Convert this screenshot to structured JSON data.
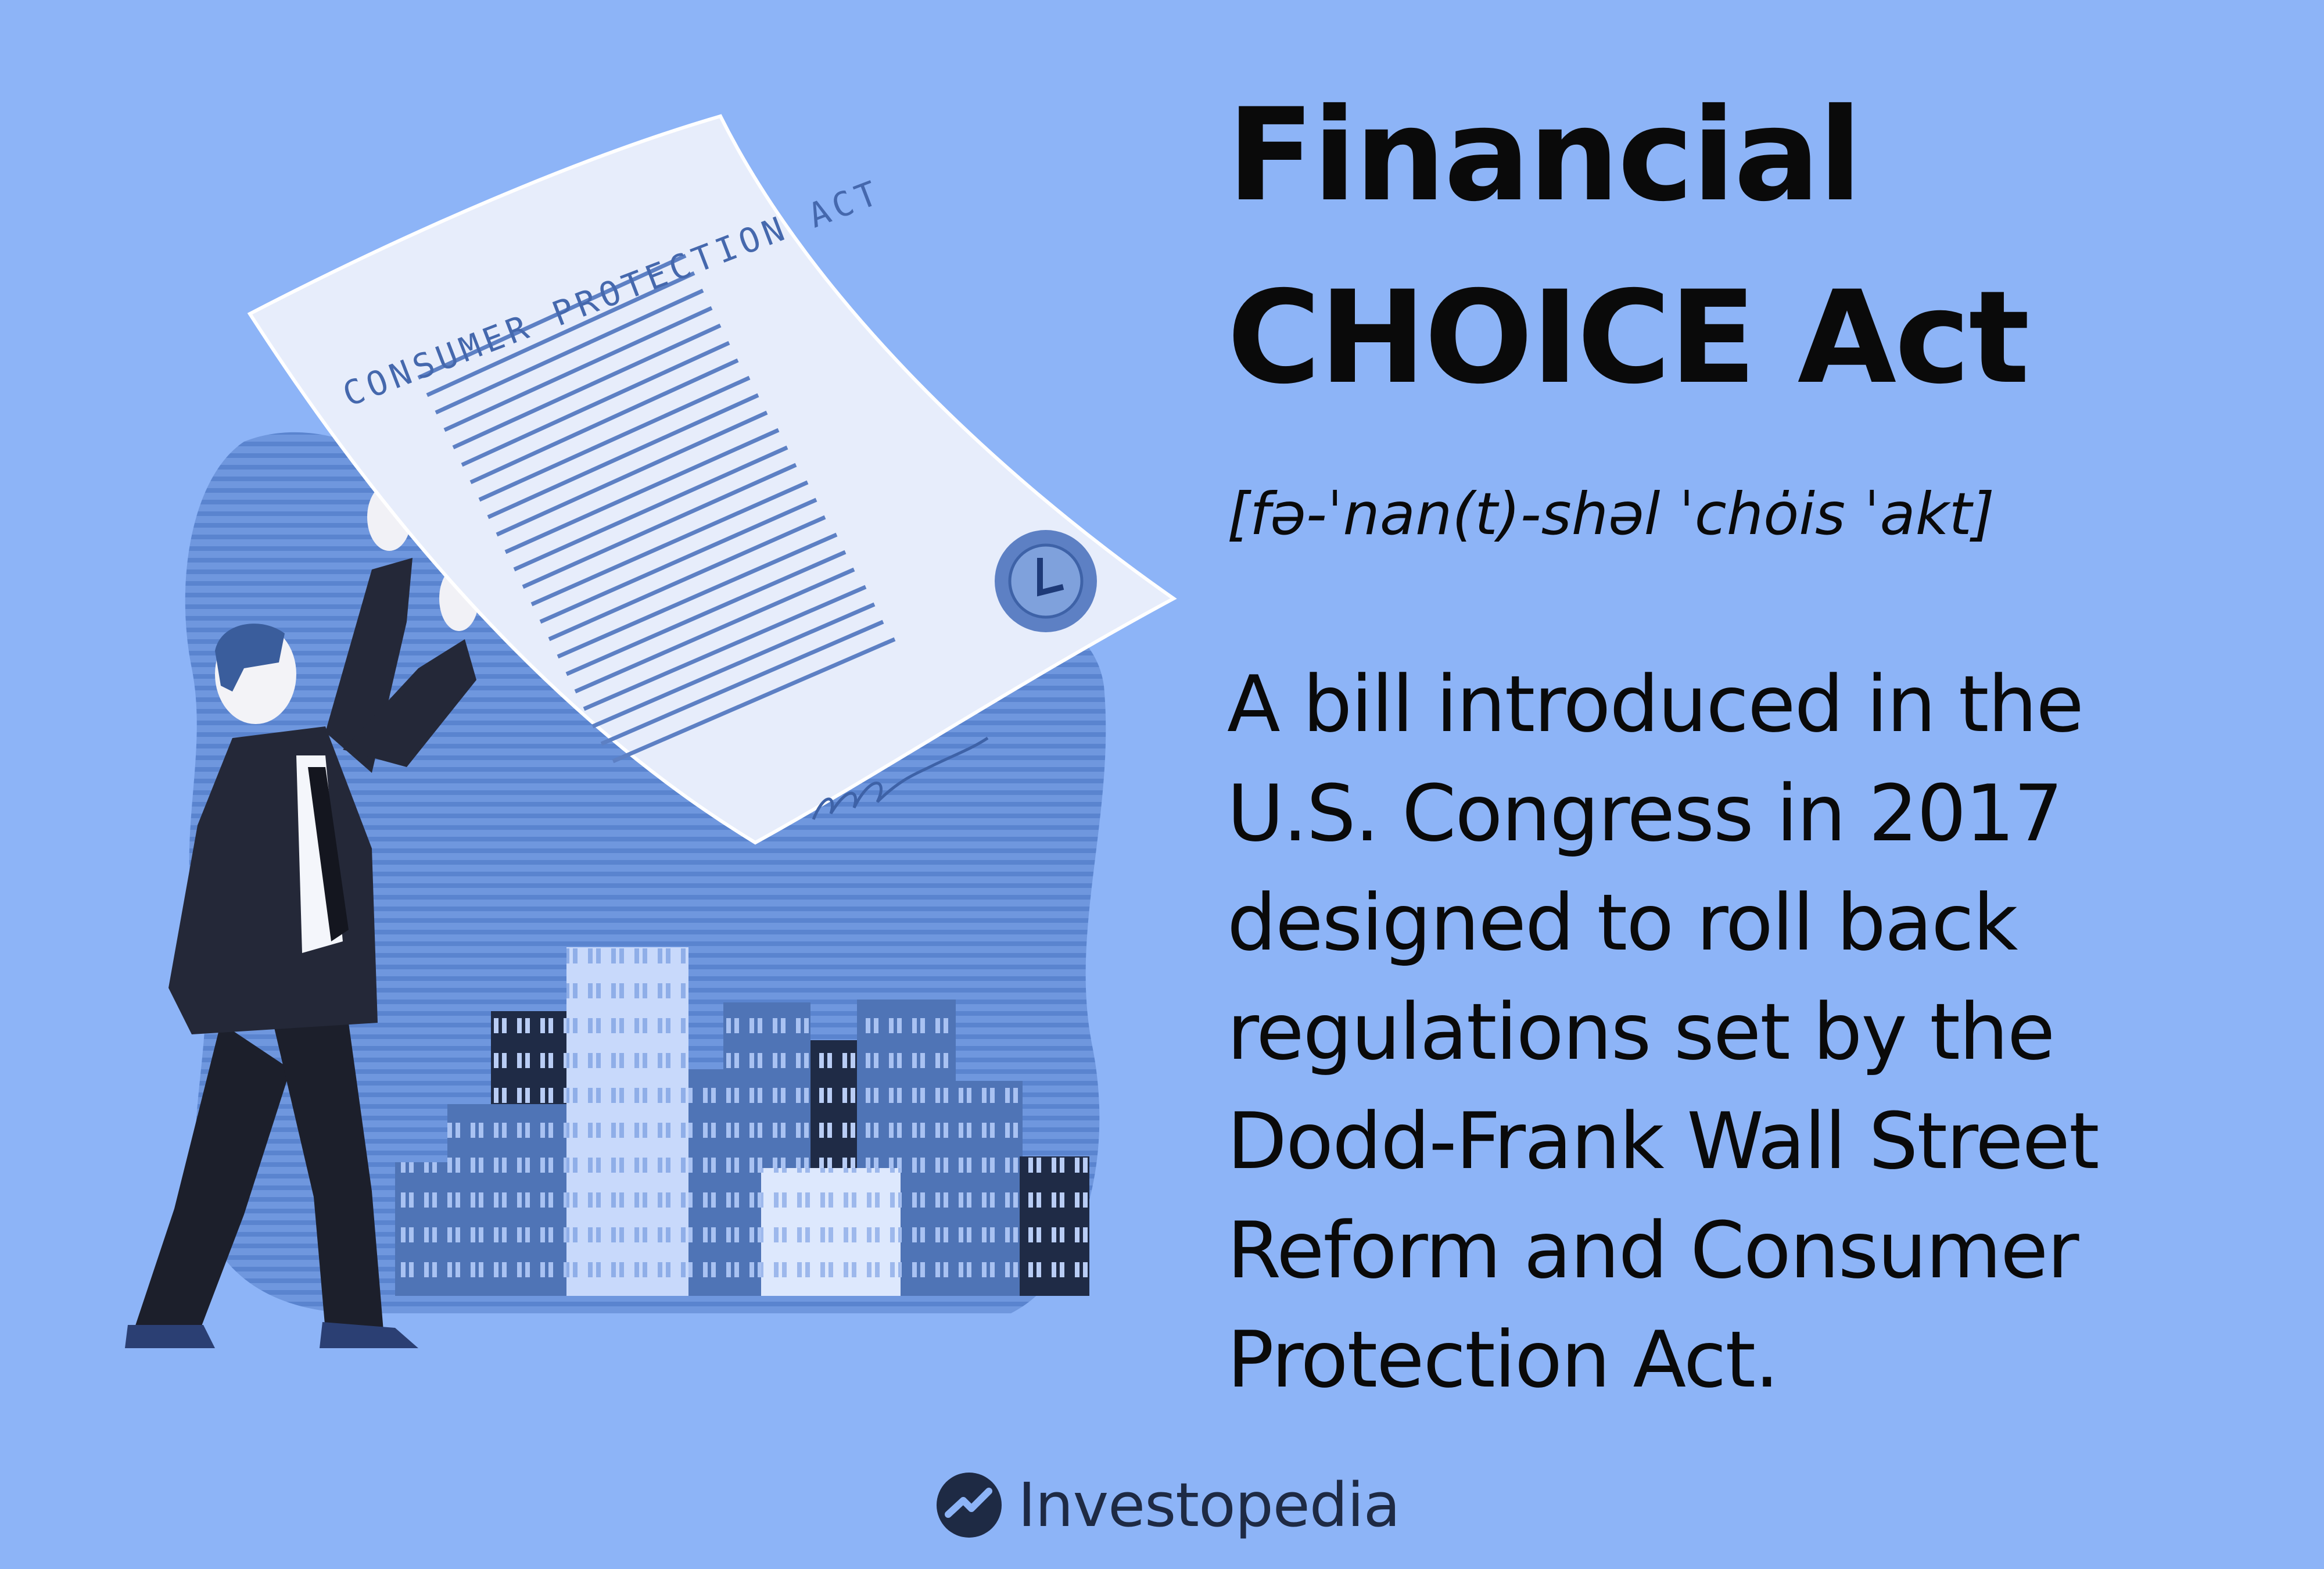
{
  "title": {
    "line1": "Financial",
    "line2": "CHOICE Act"
  },
  "pronunciation": "[fə-ˈnan(t)-shəl ˈchȯis ˈakt]",
  "definition": {
    "lines": [
      "A bill introduced in the",
      "U.S. Congress in 2017",
      "designed to roll back",
      "regulations set by the",
      "Dodd-Frank Wall Street",
      "Reform and Consumer",
      "Protection Act."
    ]
  },
  "illustration": {
    "document_heading": "CONSUMER PROTECTION ACT",
    "icons": [
      "businessman-figure",
      "document-paper",
      "seal-stamp",
      "city-buildings"
    ]
  },
  "brand": {
    "name": "Investopedia",
    "logo_icon": "investopedia-logo-icon"
  },
  "colors": {
    "background": "#8db4f7",
    "dark_navy": "#1e2a44",
    "text": "#0a0a0a"
  }
}
